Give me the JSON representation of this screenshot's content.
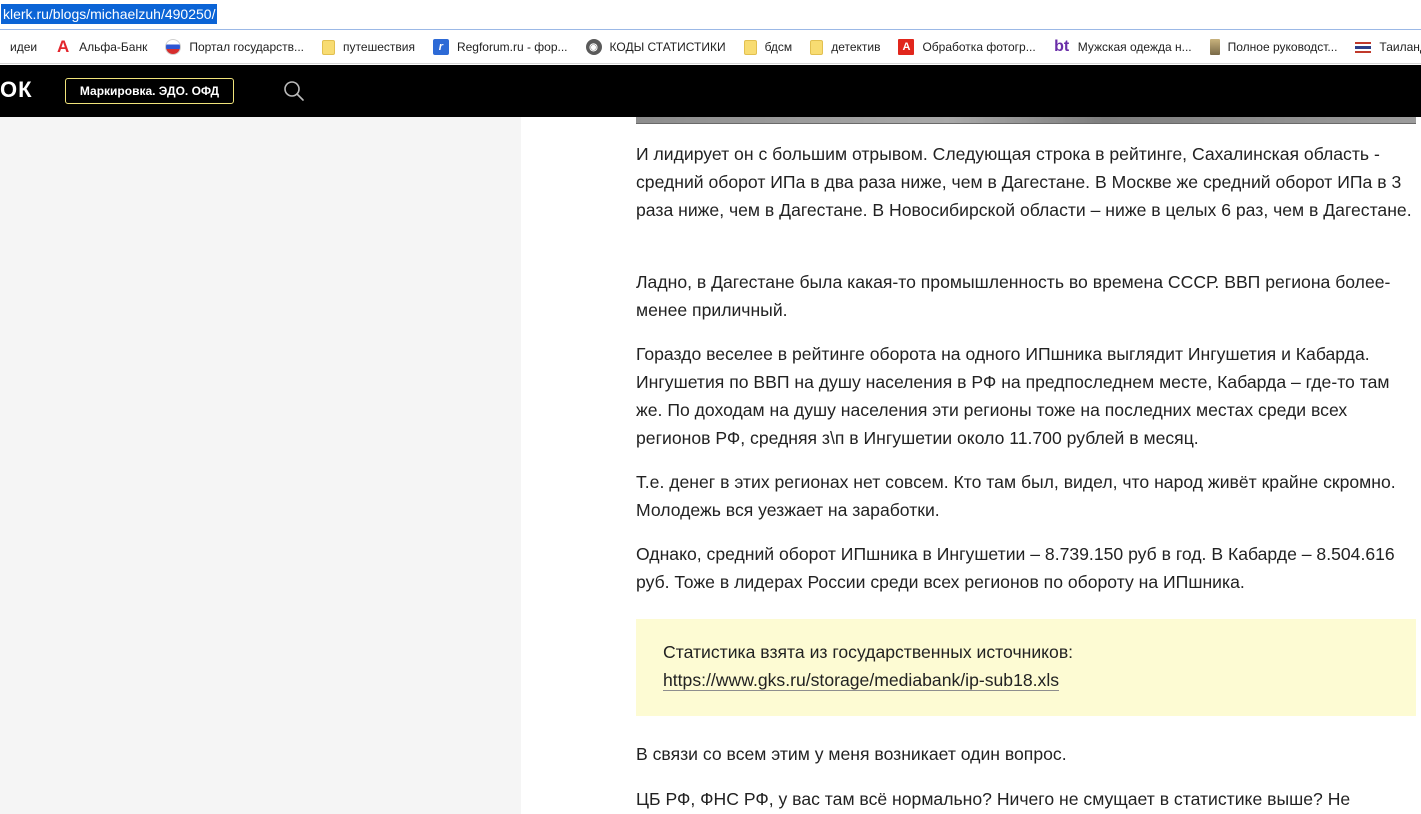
{
  "browser": {
    "url": "klerk.ru/blogs/michaelzuh/490250/"
  },
  "bookmarks": [
    {
      "label": "идеи",
      "icon": "none"
    },
    {
      "label": "Альфа-Банк",
      "icon": "alfa-bank-icon"
    },
    {
      "label": "Портал государств...",
      "icon": "russia-emblem-icon"
    },
    {
      "label": "путешествия",
      "icon": "folder-icon"
    },
    {
      "label": "Regforum.ru - фор...",
      "icon": "regforum-icon"
    },
    {
      "label": "КОДЫ СТАТИСТИКИ",
      "icon": "globe-icon"
    },
    {
      "label": "бдсм",
      "icon": "folder-icon"
    },
    {
      "label": "детектив",
      "icon": "folder-icon"
    },
    {
      "label": "Обработка фотогр...",
      "icon": "adobe-icon"
    },
    {
      "label": "Мужская одежда н...",
      "icon": "bt-icon"
    },
    {
      "label": "Полное руководст...",
      "icon": "book-icon"
    },
    {
      "label": "Таиланд",
      "icon": "thailand-flag-icon"
    }
  ],
  "header": {
    "logo_fragment": "ОК",
    "promo_button": "Маркировка. ЭДО. ОФД",
    "search_icon": "search-icon"
  },
  "article": {
    "paragraphs": [
      "И лидирует он с большим отрывом. Следующая строка в рейтинге, Сахалинская область - средний оборот ИПа в два раза ниже, чем в Дагестане. В Москве же средний оборот ИПа в 3 раза ниже, чем в Дагестане. В Новосибирской области – ниже в целых 6 раз, чем в Дагестане.",
      "Ладно, в Дагестане была какая-то промышленность во времена СССР. ВВП региона более-менее приличный.",
      "Гораздо веселее в рейтинге оборота на одного ИПшника выглядит Ингушетия и Кабарда. Ингушетия по ВВП на душу населения в РФ на предпоследнем месте, Кабарда – где-то там же. По доходам на душу населения эти регионы тоже на последних местах среди всех регионов РФ, средняя з\\п в Ингушетии около 11.700 рублей в месяц.",
      "Т.е. денег в этих регионах нет совсем. Кто там был, видел, что народ живёт крайне скромно. Молодежь вся уезжает на заработки.",
      "Однако, средний оборот ИПшника в Ингушетии – 8.739.150 руб в год. В Кабарде – 8.504.616 руб. Тоже в лидерах России среди всех регионов по обороту на ИПшника."
    ],
    "quote_text": "Статистика взята из государственных источников:",
    "quote_link": "https://www.gks.ru/storage/mediabank/ip-sub18.xls",
    "after_paragraphs": [
      "В связи со всем этим у меня возникает один вопрос.",
      "ЦБ РФ, ФНС РФ, у вас там всё нормально? Ничего не смущает в статистике выше? Не"
    ]
  },
  "colors": {
    "header_bg": "#000000",
    "promo_border": "#f0e37a",
    "quote_bg": "#fdfbd3",
    "url_highlight": "#0b64d6",
    "sidebar_bg": "#f5f5f5"
  }
}
